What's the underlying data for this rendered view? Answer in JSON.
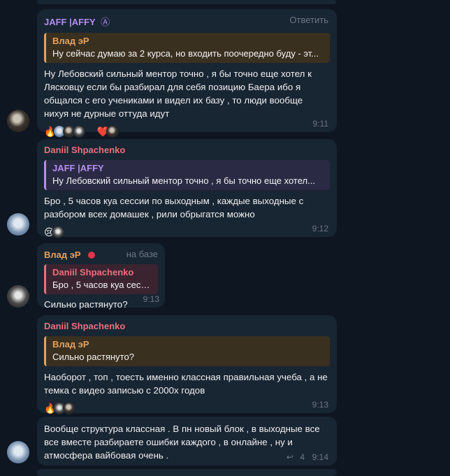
{
  "messages": [
    {
      "sender": "JAFF |AFFY",
      "sender_badge": "Ⓐ",
      "reply_label": "Ответить",
      "quote_name": "Влад эР",
      "quote_text": "Ну сейчас думаю за 2 курса, но входить поочередно буду - эт...",
      "text": "Ну Лебовский сильный ментор точно , я бы точно еще хотел к Лясковцу если бы разбирал для себя позицию Баера ибо я общался с его учениками и видел их базу , то люди вообще нихуя не дурные оттуда идут",
      "reactions": [
        "🔥",
        "❤️"
      ],
      "time": "9:11"
    },
    {
      "sender": "Daniil Shpachenko",
      "quote_name": "JAFF |AFFY",
      "quote_text": "Ну Лебовский сильный ментор точно , я бы точно еще хотел...",
      "text": "Бро , 5 часов куа сессии по выходным , каждые выходные с разбором всех домашек , рили обрыгатся можно",
      "reactions": [
        "😢"
      ],
      "time": "9:12"
    },
    {
      "sender": "Влад эР",
      "status": "на базе",
      "quote_name": "Daniil Shpachenko",
      "quote_text": "Бро , 5 часов куа сесс...",
      "text": "Сильно растянуто?",
      "time": "9:13"
    },
    {
      "sender": "Daniil Shpachenko",
      "quote_name": "Влад эР",
      "quote_text": "Сильно растянуто?",
      "text": "Наоборот , топ , тоесть именно классная правильная учеба , а не темка с видео записью с 2000х годов",
      "reactions": [
        "🔥"
      ],
      "time": "9:13"
    },
    {
      "text": "Вообще структура классная . В пн новый блок , в выходные все все вместе разбираете ошибки каждого , в онлайне , ну и атмосфера вайбовая очень .",
      "replies": "4",
      "time": "9:14"
    }
  ],
  "colors": {
    "background": "#0e1621",
    "bubble": "#182533",
    "jaff": "#b48ef0",
    "vlad": "#e8a158",
    "daniil": "#ec6f7c"
  }
}
